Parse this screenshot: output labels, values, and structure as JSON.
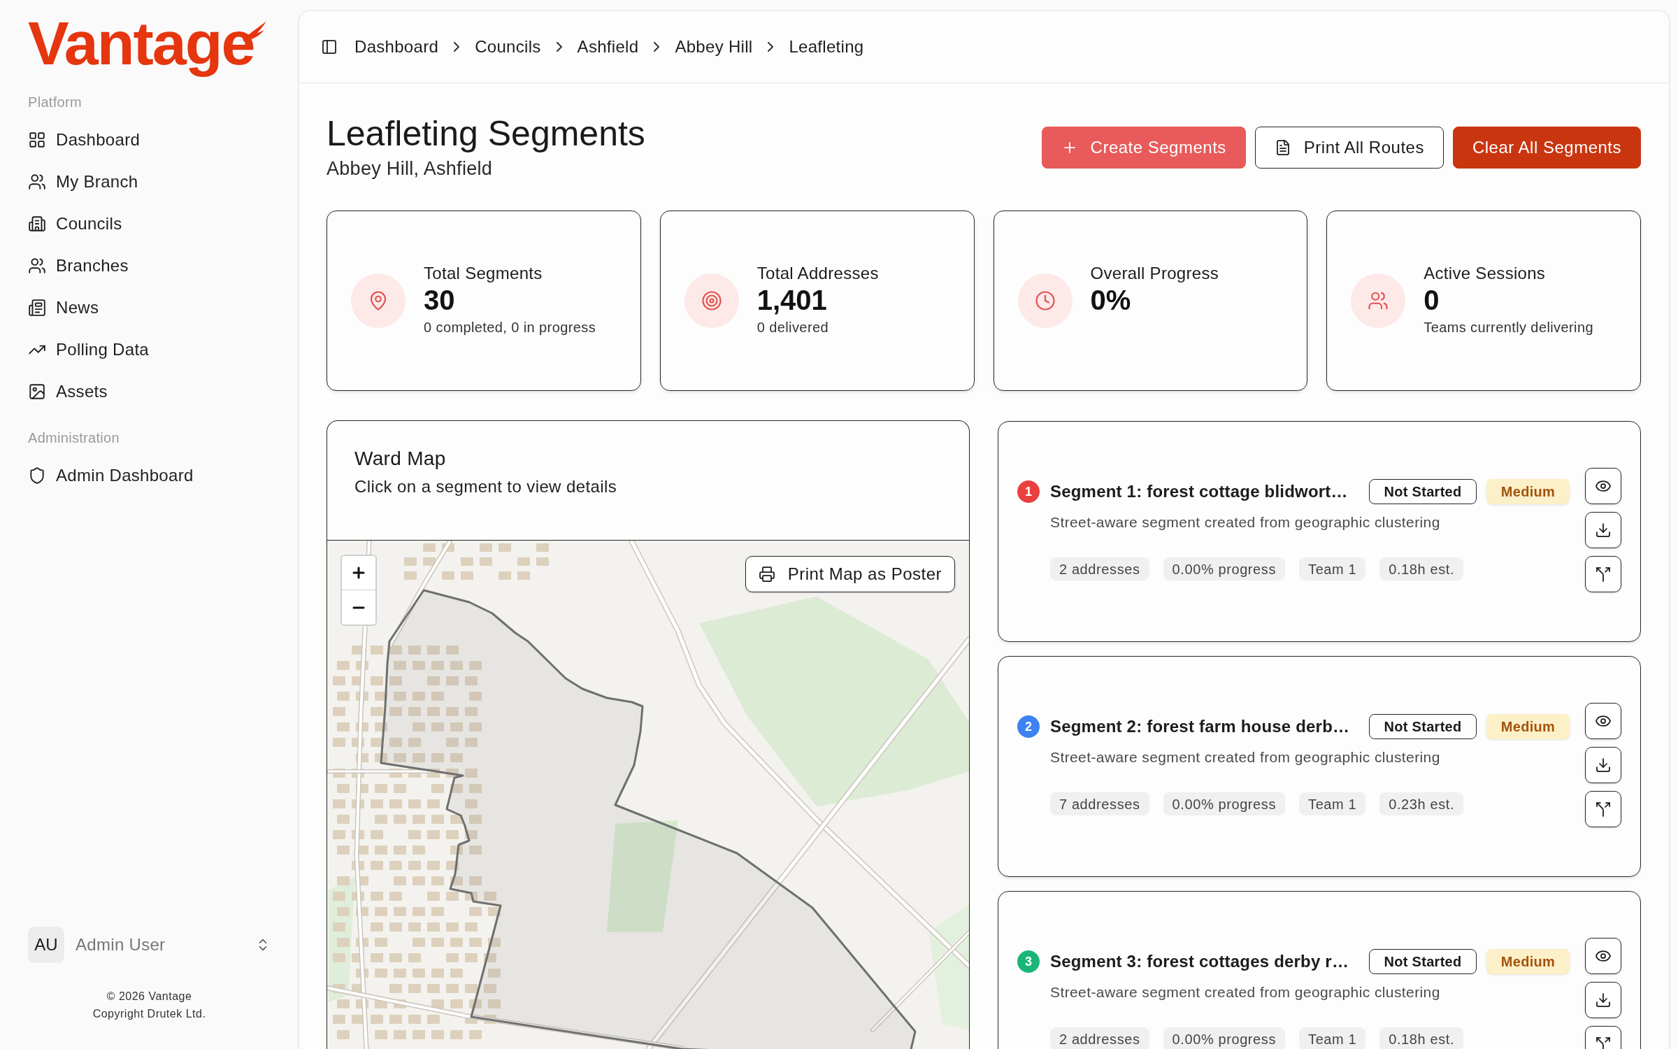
{
  "sidebar": {
    "logo": "Vantage",
    "groups": [
      {
        "label": "Platform",
        "items": [
          {
            "label": "Dashboard",
            "selected": false
          },
          {
            "label": "My Branch",
            "selected": false
          },
          {
            "label": "Councils",
            "selected": false
          },
          {
            "label": "Branches",
            "selected": false
          },
          {
            "label": "News",
            "selected": false
          },
          {
            "label": "Polling Data",
            "selected": false
          },
          {
            "label": "Assets",
            "selected": false
          }
        ]
      },
      {
        "label": "Administration",
        "items": [
          {
            "label": "Admin Dashboard",
            "selected": false
          }
        ]
      }
    ],
    "user": {
      "initials": "AU",
      "name": "Admin User"
    },
    "footer": [
      "© 2026 Vantage",
      "Copyright Drutek Ltd."
    ]
  },
  "breadcrumb": [
    "Dashboard",
    "Councils",
    "Ashfield",
    "Abbey Hill",
    "Leafleting"
  ],
  "header": {
    "title": "Leafleting Segments",
    "subtitle": "Abbey Hill, Ashfield",
    "buttons": [
      {
        "label": "Create Segments",
        "kind": "accent"
      },
      {
        "label": "Print All Routes",
        "kind": "outline"
      },
      {
        "label": "Clear All Segments",
        "kind": "danger"
      }
    ]
  },
  "stats": [
    {
      "label": "Total Segments",
      "value": "30",
      "note": "0 completed, 0 in progress"
    },
    {
      "label": "Total Addresses",
      "value": "1,401",
      "note": "0 delivered"
    },
    {
      "label": "Overall Progress",
      "value": "0%"
    },
    {
      "label": "Active Sessions",
      "value": "0",
      "note": "Teams currently delivering"
    }
  ],
  "map": {
    "title": "Ward Map",
    "subtitle": "Click on a segment to view details",
    "print_button": "Print Map as Poster"
  },
  "segments": [
    {
      "number": "1",
      "color": "#e8413f",
      "title": "Segment 1: forest cottage blidwort…",
      "status": "Not Started",
      "priority": "Medium",
      "description": "Street-aware segment created from geographic clustering",
      "chips": [
        "2 addresses",
        "0.00% progress",
        "Team 1",
        "0.18h est."
      ]
    },
    {
      "number": "2",
      "color": "#3d82f0",
      "title": "Segment 2: forest farm house derb…",
      "status": "Not Started",
      "priority": "Medium",
      "description": "Street-aware segment created from geographic clustering",
      "chips": [
        "7 addresses",
        "0.00% progress",
        "Team 1",
        "0.23h est."
      ]
    },
    {
      "number": "3",
      "color": "#1bb57a",
      "title": "Segment 3: forest cottages derby r…",
      "status": "Not Started",
      "priority": "Medium",
      "description": "Street-aware segment created from geographic clustering",
      "chips": [
        "2 addresses",
        "0.00% progress",
        "Team 1",
        "0.18h est."
      ]
    }
  ]
}
